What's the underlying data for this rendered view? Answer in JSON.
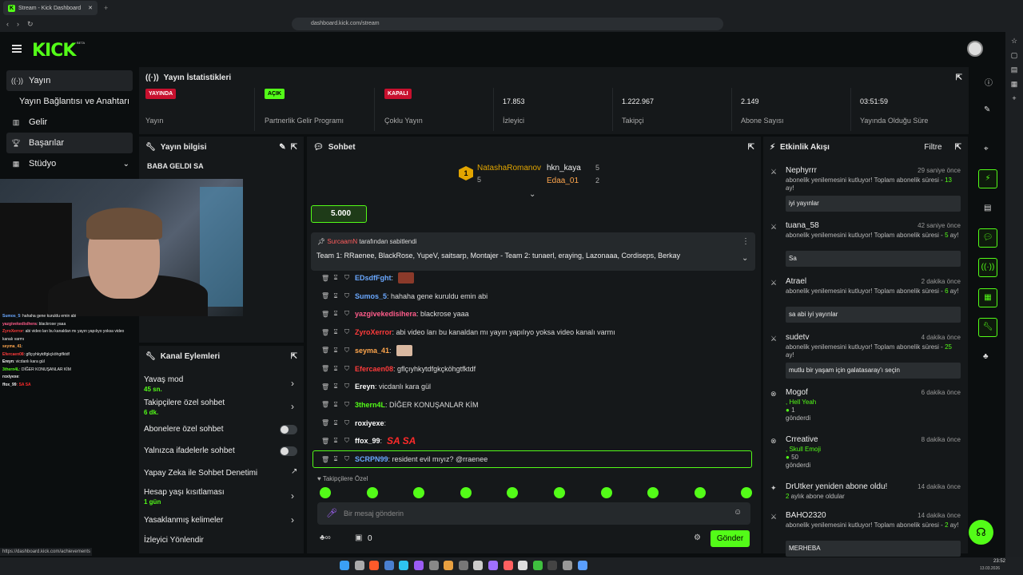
{
  "browser": {
    "tab_title": "Stream - Kick Dashboard",
    "url": "dashboard.kick.com/stream",
    "status_url": "https://dashboard.kick.com/achievements"
  },
  "app": {
    "logo": "KICK",
    "beta": "BETA"
  },
  "nav": {
    "items": [
      {
        "label": "Yayın",
        "icon": "broadcast-icon"
      },
      {
        "label": "Yayın Bağlantısı ve Anahtarı",
        "icon": ""
      },
      {
        "label": "Gelir",
        "icon": "chart-icon"
      },
      {
        "label": "Başarılar",
        "icon": "trophy-icon"
      },
      {
        "label": "Stüdyo",
        "icon": "studio-icon"
      }
    ]
  },
  "stats": {
    "title": "Yayın İstatistikleri",
    "cells": [
      {
        "badge": "YAYINDA",
        "label": "Yayın",
        "badge_color": "#c8102e"
      },
      {
        "badge": "AÇIK",
        "label": "Partnerlik Gelir Programı",
        "badge_color": "#53fc18"
      },
      {
        "badge": "KAPALI",
        "label": "Çoklu Yayın",
        "badge_color": "#c8102e"
      },
      {
        "value": "17.853",
        "label": "İzleyici"
      },
      {
        "value": "1.222.967",
        "label": "Takipçi"
      },
      {
        "value": "2.149",
        "label": "Abone Sayısı"
      },
      {
        "value": "03:51:59",
        "label": "Yayında Olduğu Süre"
      }
    ]
  },
  "stream_info": {
    "title": "Yayın bilgisi",
    "stream_title": "BABA GELDI SA"
  },
  "overlay_chat": [
    {
      "name": "Sumos_5",
      "text": ": hahaha gene kuruldu emin abi",
      "color": "#6aa8ff"
    },
    {
      "name": "yazgivekedisihera",
      "text": ": blackrose yaaa",
      "color": "#ff5c8a"
    },
    {
      "name": "ZyroXerror",
      "text": ": abi video ları bu kanaldan mı yayın yapılıyo yoksa video kanalı varmı",
      "color": "#ff3b3b"
    },
    {
      "name": "seyma_41",
      "text": ":",
      "color": "#ffa64d"
    },
    {
      "name": "Efercaen08",
      "text": ": gflçıyhkytdfgkçköhgtfktdf",
      "color": "#ff3b3b"
    },
    {
      "name": "Ereyn",
      "text": ": vicdanlı kara gül",
      "color": "#ffffff"
    },
    {
      "name": "3thern4L",
      "text": ": DİĞER KONUŞANLAR KİM",
      "color": "#53fc18"
    },
    {
      "name": "roxiyexe",
      "text": ":",
      "color": "#ffffff"
    },
    {
      "name": "ffox_99",
      "text": ": SA  SA",
      "color": "#ffffff"
    }
  ],
  "actions": {
    "title": "Kanal Eylemleri",
    "items": [
      {
        "label": "Yavaş mod",
        "sub": "45 sn."
      },
      {
        "label": "Takipçilere özel sohbet",
        "sub": "6 dk."
      },
      {
        "label": "Abonelere özel sohbet",
        "sub": ""
      },
      {
        "label": "Yalnızca ifadelerle sohbet",
        "sub": ""
      },
      {
        "label": "Yapay Zeka ile Sohbet Denetimi",
        "sub": ""
      },
      {
        "label": "Hesap yaşı kısıtlaması",
        "sub": "1 gün"
      },
      {
        "label": "Yasaklanmış kelimeler",
        "sub": ""
      },
      {
        "label": "İzleyici Yönlendir",
        "sub": ""
      }
    ]
  },
  "chat": {
    "title": "Sohbet",
    "top": [
      {
        "name": "NatashaRomanov",
        "count": "5"
      },
      {
        "name": "hkn_kaya",
        "count": "5"
      },
      {
        "name": "Edaa_01",
        "count": "2"
      }
    ],
    "rank_badge": "1",
    "kicks": "5.000",
    "pinned_by": "SurcaamN",
    "pinned_suffix": "tarafından sabitlendi",
    "pinned_text": "Team 1: RRaenee, BlackRose, YupeV, saitsarp, Montajer - Team 2: tunaerl, eraying, Lazonaaa, Cordiseps, Berkay",
    "messages": [
      {
        "name": "EDsdfFght",
        "text": ":",
        "color": "#6aa8ff"
      },
      {
        "name": "Sumos_5",
        "text": ": hahaha gene kuruldu emin abi",
        "color": "#6aa8ff"
      },
      {
        "name": "yazgivekedisihera",
        "text": ": blackrose yaaa",
        "color": "#ff5c8a"
      },
      {
        "name": "ZyroXerror",
        "text": ": abi video ları bu kanaldan mı yayın yapılıyo yoksa video kanalı varmı",
        "color": "#ff3b3b"
      },
      {
        "name": "seyma_41",
        "text": ":",
        "color": "#ffa64d"
      },
      {
        "name": "Efercaen08",
        "text": ": gflçıyhkytdfgkçköhgtfktdf",
        "color": "#ff3b3b"
      },
      {
        "name": "Ereyn",
        "text": ": vicdanlı kara gül",
        "color": "#ffffff"
      },
      {
        "name": "3thern4L",
        "text": ": DİĞER KONUŞANLAR KİM",
        "color": "#53fc18"
      },
      {
        "name": "roxiyexe",
        "text": ":",
        "color": "#ffffff"
      },
      {
        "name": "ffox_99",
        "text": ":",
        "color": "#ffffff"
      },
      {
        "name": "SCRPN99",
        "text": ": resident evil mıyız? @rraenee",
        "color": "#6aa8ff"
      }
    ],
    "sa_text": "SA SA",
    "followers_only": "Takipçilere Özel",
    "input_placeholder": "Bir mesaj gönderin",
    "points": "0",
    "send": "Gönder"
  },
  "activity": {
    "title": "Etkinlik Akışı",
    "filter": "Filtre",
    "events": [
      {
        "name": "Nephyrrr",
        "time": "29 saniye önce",
        "msg_a": "abonelik yenilemesini kutluyor! Toplam abonelik süresi - ",
        "months": "13",
        "msg_b": " ay!",
        "box": "iyi yayınlar"
      },
      {
        "name": "tuana_58",
        "time": "42 saniye önce",
        "msg_a": "abonelik yenilemesini kutluyor! Toplam abonelik süresi - ",
        "months": "5",
        "msg_b": " ay!",
        "box": "Sa"
      },
      {
        "name": "Atrael",
        "time": "2 dakika önce",
        "msg_a": "abonelik yenilemesini kutluyor! Toplam abonelik süresi - ",
        "months": "6",
        "msg_b": " ay!",
        "box": "sa abi iyi yayınlar"
      },
      {
        "name": "sudetv",
        "time": "4 dakika önce",
        "msg_a": "abonelik yenilemesini kutluyor! Toplam abonelik süresi - ",
        "months": "25",
        "msg_b": " ay!",
        "box": "mutlu bir yaşam için galatasaray'ı seçin"
      },
      {
        "name": "Mogof",
        "time": "6 dakika önce",
        "gift": ", Hell Yeah",
        "amount": "1",
        "sent": "gönderdi"
      },
      {
        "name": "Crreative",
        "time": "8 dakika önce",
        "gift": ", Skull Emoji",
        "amount": "50",
        "sent": "gönderdi"
      },
      {
        "name": "DrUtker yeniden abone oldu!",
        "time": "14 dakika önce",
        "months": "2",
        "msg_b": " aylık abone oldular"
      },
      {
        "name": "BAHO2320",
        "time": "14 dakika önce",
        "msg_a": "abonelik yenilemesini kutluyor! Toplam abonelik süresi - ",
        "months": "2",
        "msg_b": " ay!",
        "box": "MERHEBA"
      }
    ]
  },
  "taskbar": {
    "time": "23:52",
    "date": "13.03.2026"
  }
}
